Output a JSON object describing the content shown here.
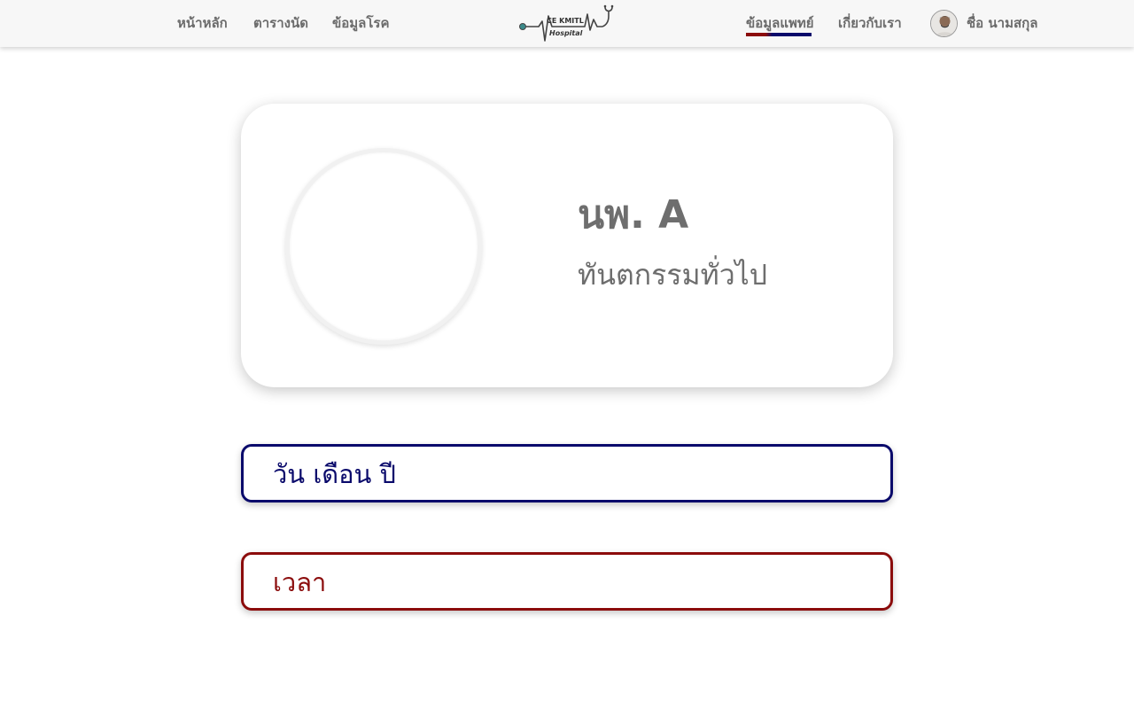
{
  "navbar": {
    "links": {
      "home": "หน้าหลัก",
      "appointments": "ตารางนัด",
      "diseases": "ข้อมูลโรค",
      "doctors": "ข้อมูลแพทย์",
      "about": "เกี่ยวกับเรา"
    },
    "active_link": "doctors",
    "logo": {
      "line1": "CE KMITL",
      "line2": "Hospital"
    },
    "user": {
      "name": "ชื่อ นามสกุล",
      "avatar_icon": "user-avatar"
    }
  },
  "profile": {
    "doctor_name": "นพ. A",
    "specialty": "ทันตกรรมทั่วไป",
    "photo_icon": "empty-photo-circle"
  },
  "booking": {
    "date_label": "วัน เดือน ปี",
    "time_label": "เวลา"
  },
  "colors": {
    "navy": "#0a0a6b",
    "maroon": "#8b0c0c",
    "text_gray": "#6e6e6e",
    "navbar_bg": "#f7f7f7"
  }
}
